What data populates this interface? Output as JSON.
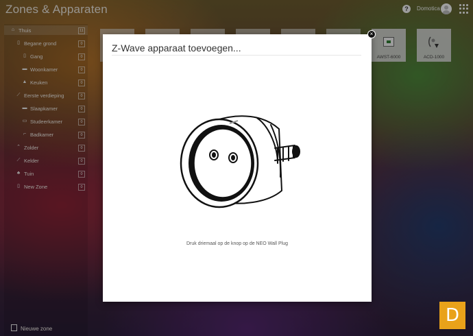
{
  "header": {
    "title": "Zones & Apparaten",
    "help_symbol": "?",
    "user_name": "Domotica"
  },
  "sidebar": {
    "items": [
      {
        "label": "Thuis",
        "count": "11",
        "icon": "home-icon"
      },
      {
        "label": "Begane grond",
        "count": "0",
        "icon": "floor-icon"
      },
      {
        "label": "Gang",
        "count": "0",
        "icon": "door-icon"
      },
      {
        "label": "Woonkamer",
        "count": "0",
        "icon": "sofa-icon"
      },
      {
        "label": "Keuken",
        "count": "0",
        "icon": "kitchen-icon"
      },
      {
        "label": "Eerste verdieping",
        "count": "0",
        "icon": "stairs-icon"
      },
      {
        "label": "Slaapkamer",
        "count": "0",
        "icon": "bed-icon"
      },
      {
        "label": "Studeerkamer",
        "count": "0",
        "icon": "desk-icon"
      },
      {
        "label": "Badkamer",
        "count": "0",
        "icon": "shower-icon"
      },
      {
        "label": "Zolder",
        "count": "0",
        "icon": "attic-icon"
      },
      {
        "label": "Kelder",
        "count": "0",
        "icon": "cellar-icon"
      },
      {
        "label": "Tuin",
        "count": "0",
        "icon": "plant-icon"
      },
      {
        "label": "New Zone",
        "count": "0",
        "icon": "door-icon"
      }
    ],
    "footer_label": "Nieuwe zone"
  },
  "devices": [
    {
      "label": ""
    },
    {
      "label": ""
    },
    {
      "label": ""
    },
    {
      "label": ""
    },
    {
      "label": ""
    },
    {
      "label": ""
    },
    {
      "label": "AWST-6000",
      "icon": "thermostat-icon"
    },
    {
      "label": "ACD-1000",
      "icon": "sensor-icon"
    }
  ],
  "modal": {
    "title": "Z-Wave apparaat toevoegen...",
    "image": "wall-plug-icon",
    "instruction": "Druk driemaal op de knop op de NEO Wall Plug",
    "close_symbol": "×"
  },
  "logo": {
    "letter": "D",
    "color": "#e9a21a"
  }
}
